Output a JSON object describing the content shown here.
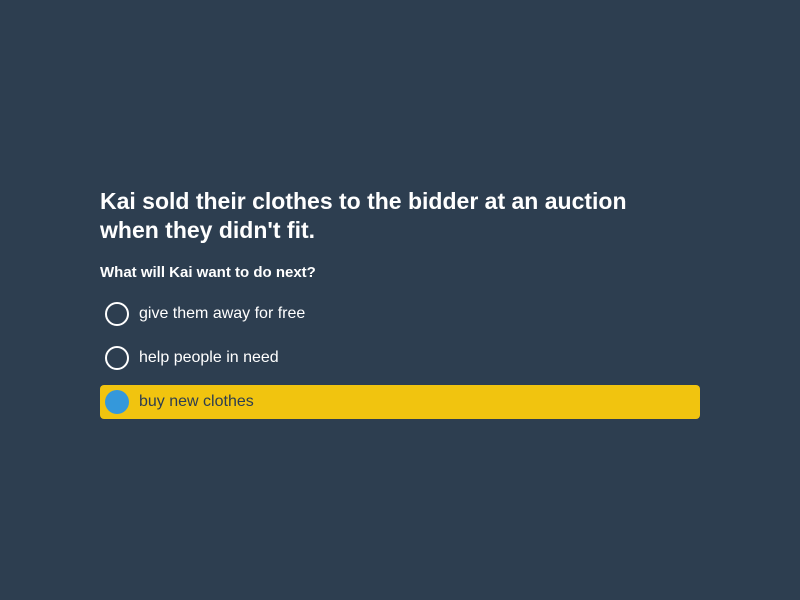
{
  "quiz": {
    "question": "Kai sold their clothes to the bidder at an auction when they didn't fit.",
    "prompt": "What will Kai want to do next?",
    "options": [
      {
        "label": "give them away for free",
        "selected": false
      },
      {
        "label": "help people in need",
        "selected": false
      },
      {
        "label": "buy new clothes",
        "selected": true
      }
    ]
  },
  "colors": {
    "background": "#2d3e50",
    "selected_highlight": "#f1c40f",
    "selected_radio": "#3498db",
    "text": "#ffffff"
  }
}
